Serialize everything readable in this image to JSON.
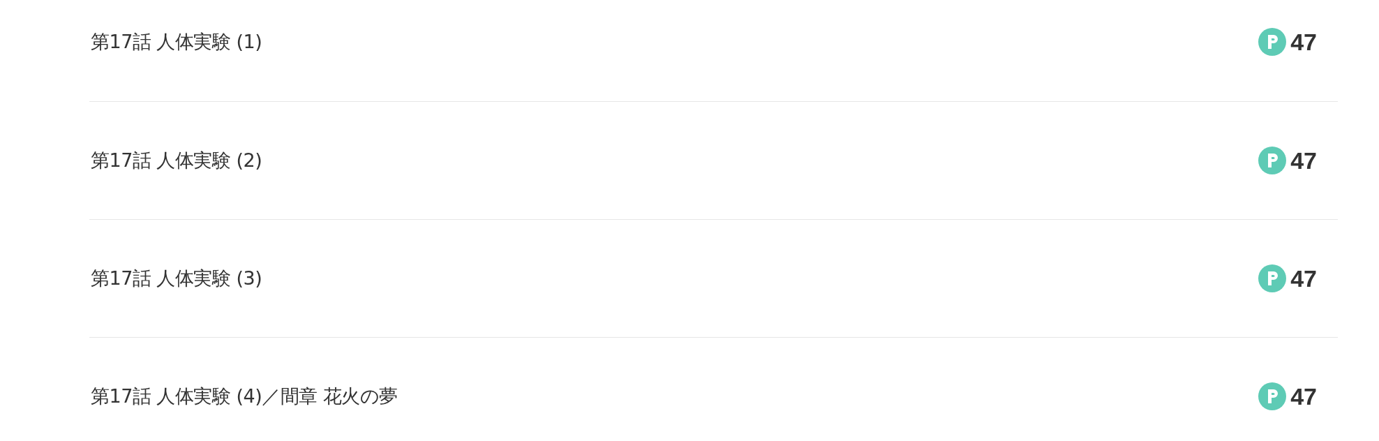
{
  "episodes": [
    {
      "title": "第17話 人体実験 (1)",
      "points": "47"
    },
    {
      "title": "第17話 人体実験 (2)",
      "points": "47"
    },
    {
      "title": "第17話 人体実験 (3)",
      "points": "47"
    },
    {
      "title": "第17話 人体実験 (4)／間章 花火の夢",
      "points": "47"
    }
  ]
}
